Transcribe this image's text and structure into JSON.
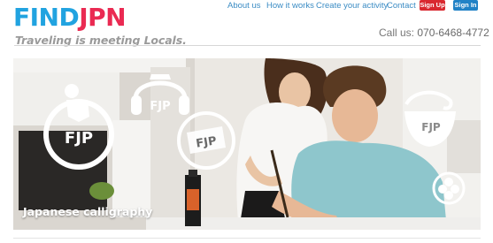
{
  "brand": {
    "logo_left": "FIND",
    "logo_right": "JPN",
    "tagline": "Traveling is meeting Locals."
  },
  "nav": {
    "links": [
      "About us",
      "How it works",
      "Create your activity",
      "Contact"
    ],
    "sign_up": "Sign Up",
    "sign_in": "Sign In"
  },
  "contact": {
    "label": "Call us:",
    "phone": "070-6468-4772"
  },
  "hero": {
    "caption": "Japanese calligraphy",
    "icon_text": "FJP",
    "icons": [
      "fjp-person-icon",
      "fjp-headphones-icon",
      "fjp-sign-icon",
      "fjp-bowl-icon",
      "flower-icon"
    ]
  },
  "colors": {
    "brand_blue": "#21a3e0",
    "brand_red": "#ea2a52",
    "link": "#3b8cc4",
    "signup": "#d9282f",
    "signin": "#2182c6"
  }
}
